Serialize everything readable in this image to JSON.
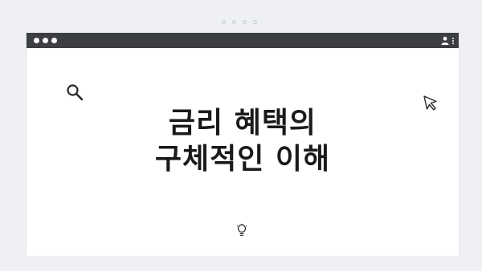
{
  "browser": {
    "window_controls": [
      "close",
      "minimize",
      "maximize"
    ],
    "right_icons": [
      "user-icon",
      "more-vert-icon"
    ]
  },
  "page": {
    "icons": [
      "search-icon",
      "cursor-icon",
      "lightbulb-icon"
    ],
    "headline_line1": "금리 혜택의",
    "headline_line2": "구체적인 이해"
  },
  "colors": {
    "background": "#eef0f4",
    "titlebar": "#3c3e43",
    "card": "#ffffff",
    "text": "#1a1a1a"
  }
}
